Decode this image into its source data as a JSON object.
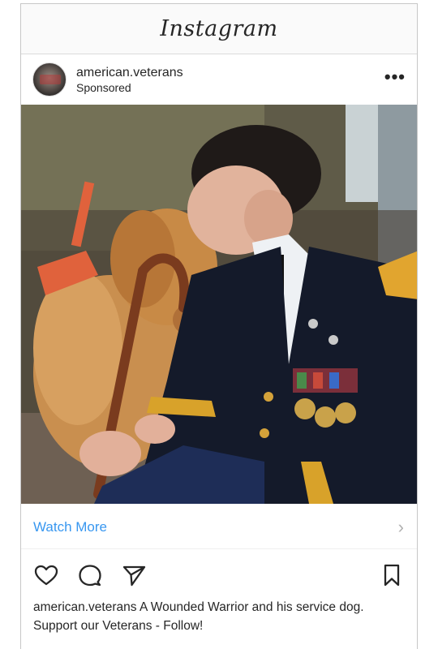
{
  "app": {
    "logo_text": "Instagram"
  },
  "post": {
    "username": "american.veterans",
    "subtitle": "Sponsored",
    "more_label": "•••",
    "cta_label": "Watch More",
    "cta_chevron": "›",
    "caption_user": "american.veterans",
    "caption_text": "A Wounded Warrior and his service dog. Support our Veterans - Follow!"
  },
  "icons": {
    "like": "heart-icon",
    "comment": "comment-icon",
    "share": "send-icon",
    "save": "bookmark-icon",
    "more": "more-icon",
    "chevron": "chevron-right-icon"
  },
  "colors": {
    "link": "#3897f0",
    "text": "#262626",
    "border": "#dbdbdb"
  }
}
